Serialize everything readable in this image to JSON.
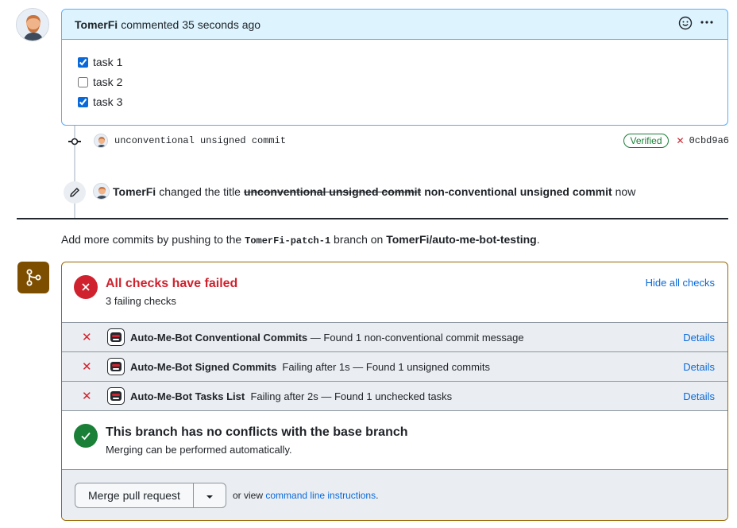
{
  "comment": {
    "author": "TomerFi",
    "meta": "commented 35 seconds ago",
    "tasks": [
      {
        "label": "task 1",
        "checked": true
      },
      {
        "label": "task 2",
        "checked": false
      },
      {
        "label": "task 3",
        "checked": true
      }
    ]
  },
  "commit": {
    "message": "unconventional unsigned commit",
    "verified_label": "Verified",
    "status_glyph": "✕",
    "sha": "0cbd9a6"
  },
  "title_change": {
    "author": "TomerFi",
    "action": "changed the title",
    "old_title": "unconventional unsigned commit",
    "new_title": "non-conventional unsigned commit",
    "time": "now"
  },
  "push_note": {
    "prefix": "Add more commits by pushing to the",
    "branch": "TomerFi-patch-1",
    "middle": "branch on",
    "repo": "TomerFi/auto-me-bot-testing",
    "suffix": "."
  },
  "checks": {
    "title": "All checks have failed",
    "subtitle": "3 failing checks",
    "hide_label": "Hide all checks",
    "items": [
      {
        "name": "Auto-Me-Bot Conventional Commits",
        "desc": "— Found 1 non-conventional commit message",
        "details": "Details"
      },
      {
        "name": "Auto-Me-Bot Signed Commits",
        "desc": "Failing after 1s — Found 1 unsigned commits",
        "details": "Details"
      },
      {
        "name": "Auto-Me-Bot Tasks List",
        "desc": "Failing after 2s — Found 1 unchecked tasks",
        "details": "Details"
      }
    ]
  },
  "conflicts": {
    "title": "This branch has no conflicts with the base branch",
    "subtitle": "Merging can be performed automatically."
  },
  "merge": {
    "button_label": "Merge pull request",
    "or_view": "or view",
    "cli_link": "command line instructions",
    "suffix": "."
  },
  "colors": {
    "accent": "#0969da",
    "fail": "#cf222e",
    "success": "#1a7f37",
    "merge_icon_bg": "#7d4e00"
  }
}
